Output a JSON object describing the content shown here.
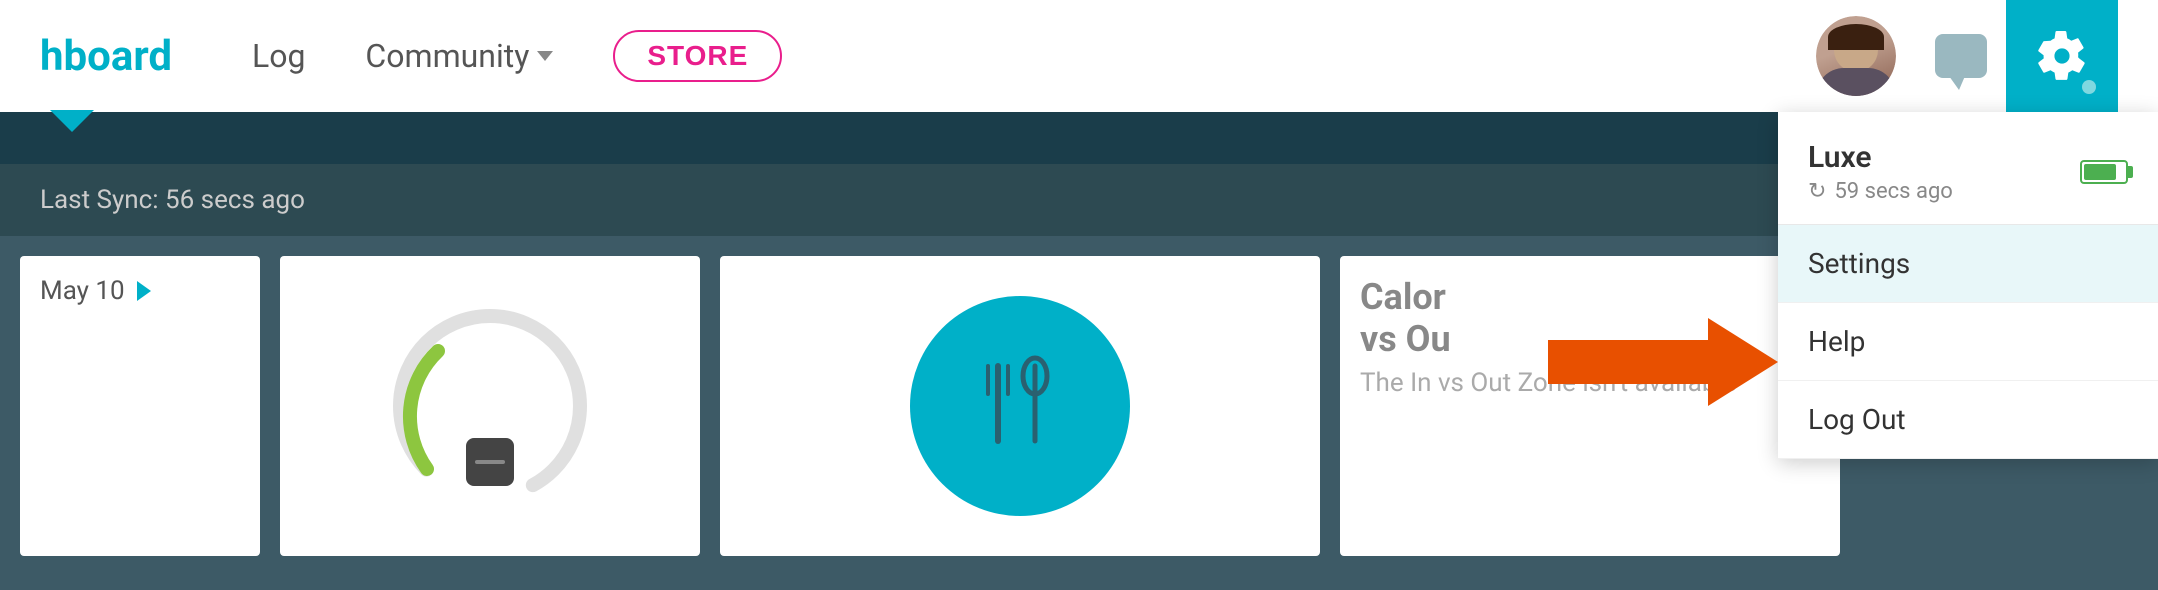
{
  "header": {
    "brand": "hboard",
    "nav": {
      "log_label": "Log",
      "community_label": "Community",
      "store_label": "STORE"
    },
    "colors": {
      "brand": "#00b0c8",
      "store_border": "#e91e8c",
      "gear_bg": "#00b0c8",
      "teal_bar": "#1a4a55",
      "dark_bg": "#3d5a66"
    }
  },
  "sync_bar": {
    "label": "Last Sync: 56 secs ago"
  },
  "dropdown": {
    "device_name": "Luxe",
    "sync_time": "59 secs ago",
    "items": [
      {
        "label": "Settings",
        "active": true
      },
      {
        "label": "Help",
        "active": false
      },
      {
        "label": "Log Out",
        "active": false
      }
    ]
  },
  "date_nav": {
    "label": "May 10",
    "chevron": "›"
  },
  "calorie": {
    "title_line1": "Calor",
    "title_line2": "vs Ou",
    "subtitle": "The In vs Out Zone isn't available"
  },
  "icons": {
    "gear": "⚙",
    "chat": "💬",
    "sync": "↻",
    "fork_knife": "🍴"
  }
}
